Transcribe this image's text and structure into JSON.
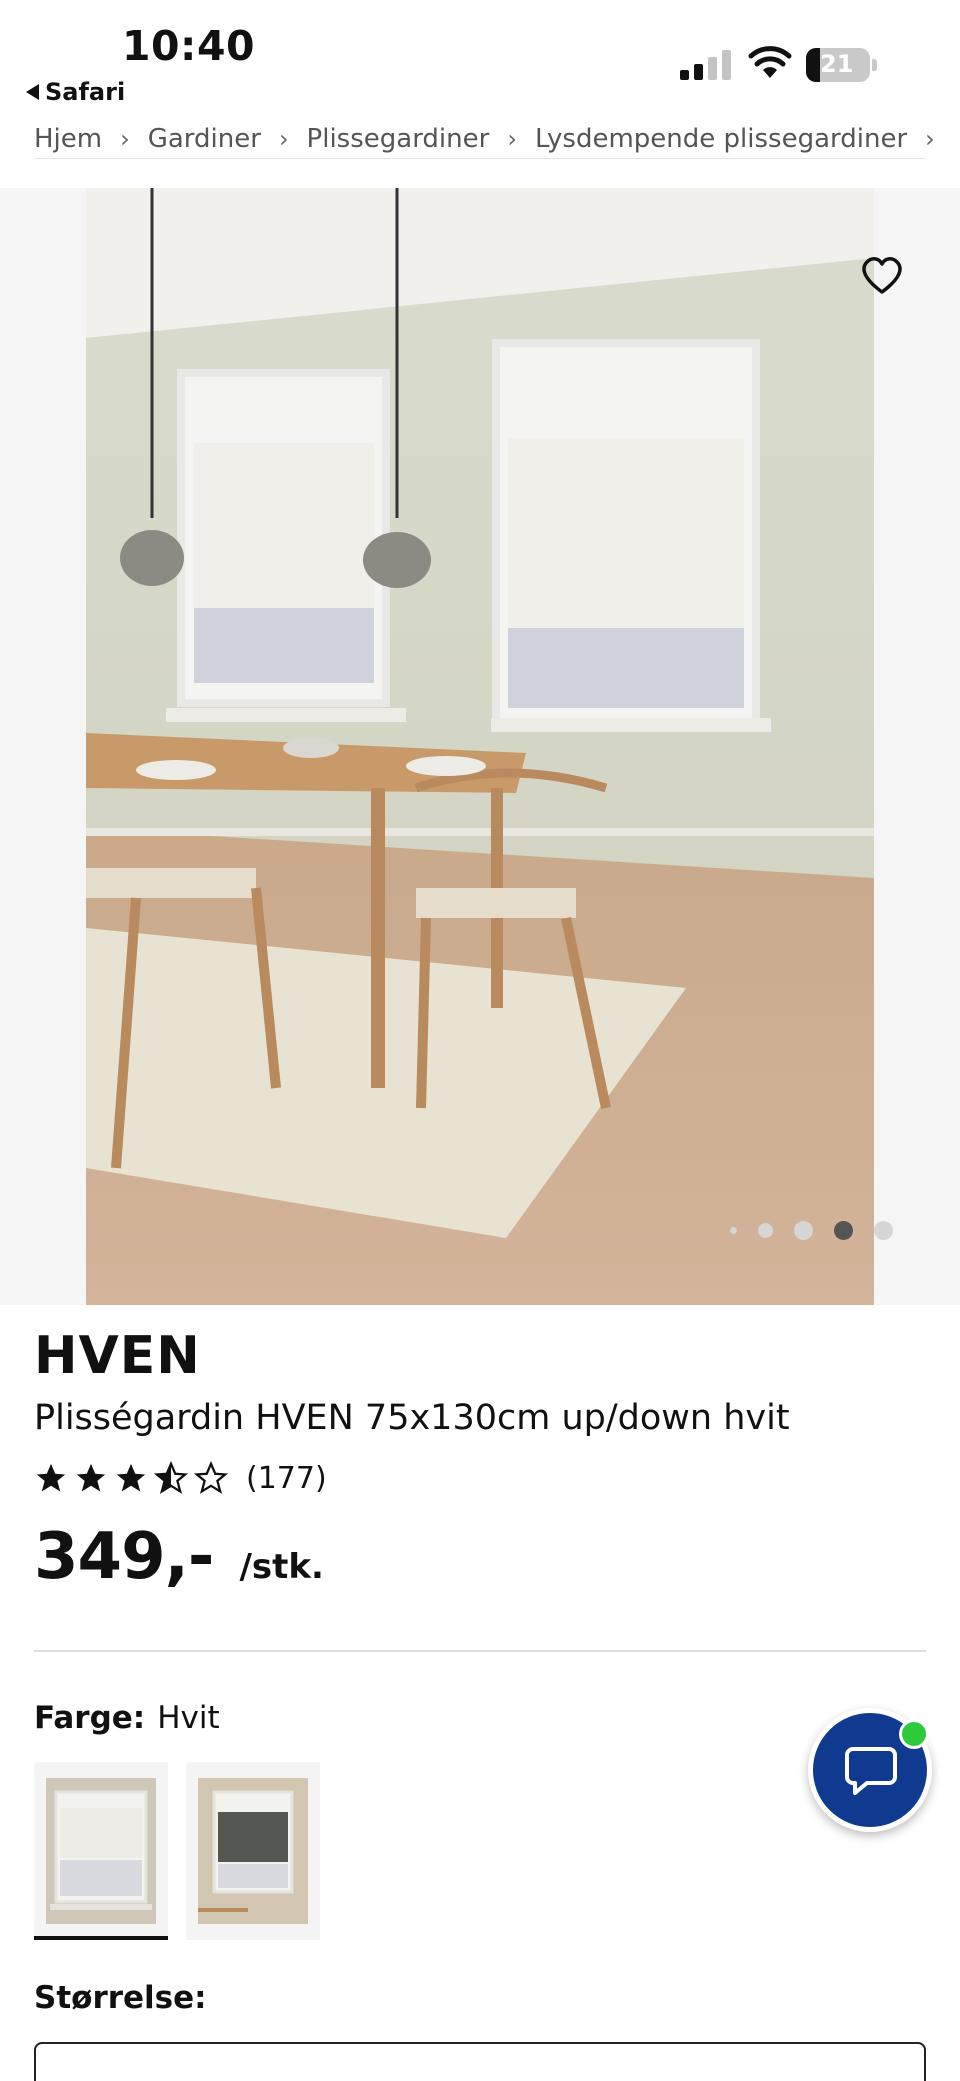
{
  "status_bar": {
    "time": "10:40",
    "back_app": "Safari",
    "battery_level": "21"
  },
  "breadcrumb": [
    "Hjem",
    "Gardiner",
    "Plissegardiner",
    "Lysdempende plissegardiner"
  ],
  "gallery": {
    "image_count": 5,
    "active_index": 3
  },
  "product": {
    "brand": "HVEN",
    "title": "Plisségardin HVEN 75x130cm up/down hvit",
    "rating_value": 3.5,
    "rating_count": "(177)",
    "price": "349,-",
    "price_unit": "/stk."
  },
  "color": {
    "label": "Farge:",
    "value": "Hvit",
    "options": [
      "white-swatch",
      "grey-swatch"
    ]
  },
  "size": {
    "label": "Størrelse:"
  },
  "colors": {
    "chat_button": "#103a8f",
    "online_indicator": "#2ccb3c"
  }
}
